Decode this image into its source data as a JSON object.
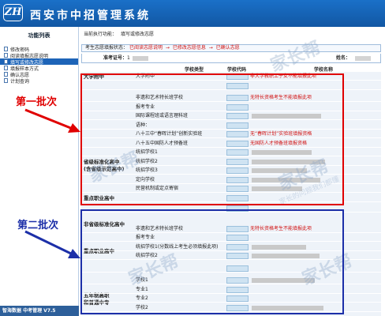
{
  "header": {
    "logo": "ZH",
    "title": "西安市中招管理系统"
  },
  "sidebar": {
    "title": "功能列表",
    "items": [
      {
        "label": "修改密码",
        "active": false
      },
      {
        "label": "阅读填报志愿说明",
        "active": false
      },
      {
        "label": "填写或修改志愿",
        "active": true
      },
      {
        "label": "填报样本方式",
        "active": false
      },
      {
        "label": "确认志愿",
        "active": false
      },
      {
        "label": "计划查询",
        "active": false
      }
    ],
    "footer": "智海数据   中考管理 V7.5"
  },
  "main": {
    "crumb_label": "当前执行功能：",
    "crumb_value": "填写或修改志愿",
    "flow": {
      "label": "考生志愿填报状态：",
      "step1": "已阅读志愿说明",
      "step2": "已修改志愿信息",
      "step3": "已确认志愿",
      "arrow": "→"
    },
    "id_label": "准考证号：",
    "id_value": "1",
    "name_label": "姓名：",
    "columns": {
      "type": "学校类型",
      "code": "学校代码",
      "name": "学校名称"
    },
    "rows": [
      {
        "type": "大学附中",
        "name": "非大学教职工子女不能填报此项"
      },
      {
        "type": "",
        "name": ""
      },
      {
        "type": "非遗和艺术特长班学校",
        "name": "无特长资格考生不能填报此项"
      },
      {
        "type": "报考专业",
        "name": ""
      },
      {
        "type": "国际课程班或语言理科班",
        "name": ""
      },
      {
        "type": "语种：",
        "name": ""
      },
      {
        "type": "八十三中“春晖计划”创新实验班",
        "name": "无“春晖计划”实验班填报资格"
      },
      {
        "type": "八十五中国防人才预备班",
        "name": "无国防人才预备班填报资格"
      },
      {
        "type": "统招学校1",
        "name": ""
      },
      {
        "type": "统招学校2",
        "name": ""
      },
      {
        "type": "统招学校3",
        "name": ""
      },
      {
        "type": "定向学校",
        "name": ""
      },
      {
        "type": "民营机制或定点寄宿",
        "name": ""
      },
      {
        "type": "",
        "name": ""
      },
      {
        "type": "",
        "name": ""
      },
      {
        "type": "非遗和艺术特长班学校",
        "name": "无特长资格考生不能填报此项"
      },
      {
        "type": "报考专业",
        "name": ""
      },
      {
        "type": "统招学校1(分数线上考生必须填报此项)",
        "name": ""
      },
      {
        "type": "统招学校2",
        "name": ""
      },
      {
        "type": "",
        "name": ""
      },
      {
        "type": "学校1",
        "name": ""
      },
      {
        "type": "专业1",
        "name": ""
      },
      {
        "type": "专业2",
        "name": ""
      },
      {
        "type": "学校2",
        "name": ""
      }
    ],
    "categories": {
      "university": "大学附中",
      "provincial_line1": "省级标准化高中",
      "provincial_line2": "(含省级示范高中)",
      "key_vocational1": "重点职业高中",
      "non_provincial": "非省级标准化高中",
      "key_vocational2": "重点职业高中",
      "five_year_line1": "五年制高职",
      "five_year_line2": "和普通中专"
    }
  },
  "annotations": {
    "batch1": "第一批次",
    "batch2": "第二批次"
  },
  "watermark": {
    "text": "家长帮",
    "sub": "家长的问题我们都懂"
  },
  "colors": {
    "header": "#1a70c8",
    "active": "#1d64b8",
    "red": "#d01010",
    "batch1": "#e00000",
    "batch2": "#1c2fa8"
  }
}
